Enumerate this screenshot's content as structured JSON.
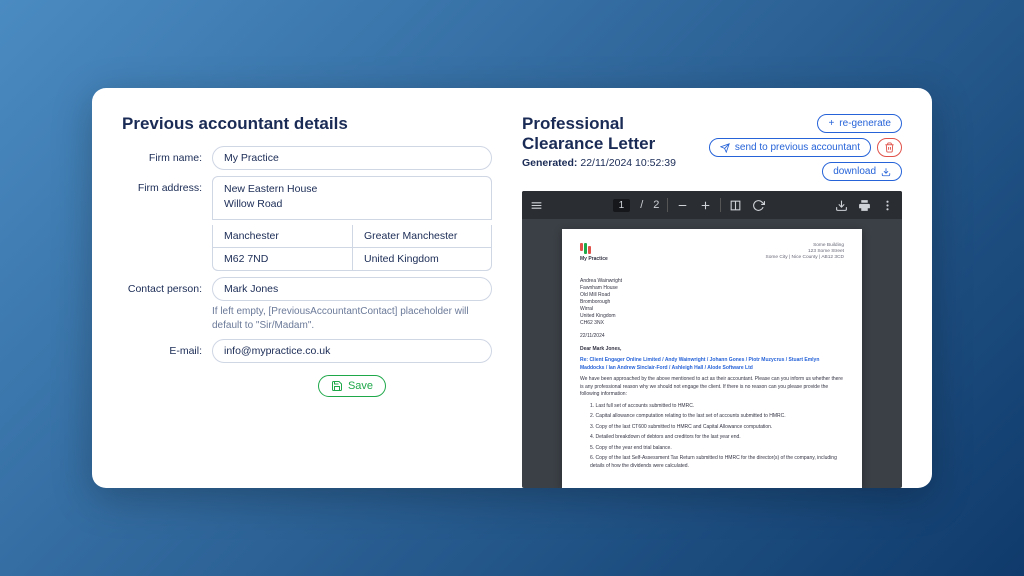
{
  "left": {
    "title": "Previous accountant details",
    "firm_name_label": "Firm name:",
    "firm_name": "My Practice",
    "firm_address_label": "Firm address:",
    "street": "New Eastern House\nWillow Road",
    "city": "Manchester",
    "region": "Greater Manchester",
    "postcode": "M62 7ND",
    "country": "United Kingdom",
    "contact_label": "Contact person:",
    "contact": "Mark Jones",
    "contact_hint": "If left empty, [PreviousAccountantContact] placeholder will default to \"Sir/Madam\".",
    "email_label": "E-mail:",
    "email": "info@mypractice.co.uk",
    "save_label": "Save"
  },
  "right": {
    "title": "Professional Clearance Letter",
    "generated_label": "Generated:",
    "generated": "22/11/2024 10:52:39",
    "regen": "re-generate",
    "send": "send to previous accountant",
    "download": "download"
  },
  "pdf": {
    "page": "1",
    "pages_sep": "/",
    "pages_total": "2"
  },
  "doc": {
    "logo_text": "My Practice",
    "sender_lines": "Some Building\n123 Some Street\nSome City | Nice County | AB12 3CD",
    "recipient": "Andrea Wainwright\nFawnham House\nOld Mill Road\nBromborough\nWirral\nUnited Kingdom\nCH62 3NX",
    "date": "22/11/2024",
    "salutation": "Dear Mark Jones,",
    "re": "Re: Client Engager Online Limited / Andy Wainwright / Johann Gones / Piotr Muzycrus / Stuart Emlyn Maddocks / Ian Andrew Sinclair-Ford / Ashleigh Hall / Alode Software Ltd",
    "para": "We have been approached by the above mentioned to act as their accountant. Please can you inform us whether there is any professional reason why we should not engage the client. If there is no reason can you please provide the following information:",
    "items": [
      "Last full set of accounts submitted to HMRC.",
      "Capital allowance computation relating to the last set of accounts submitted to HMRC.",
      "Copy of the last CT600 submitted to HMRC and Capital Allowance computation.",
      "Detailed breakdown of debtors and creditors for the last year end.",
      "Copy of the year end trial balance.",
      "Copy of the last Self-Assessment Tax Return submitted to HMRC for the director(s) of the company, including details of how the dividends were calculated."
    ]
  }
}
